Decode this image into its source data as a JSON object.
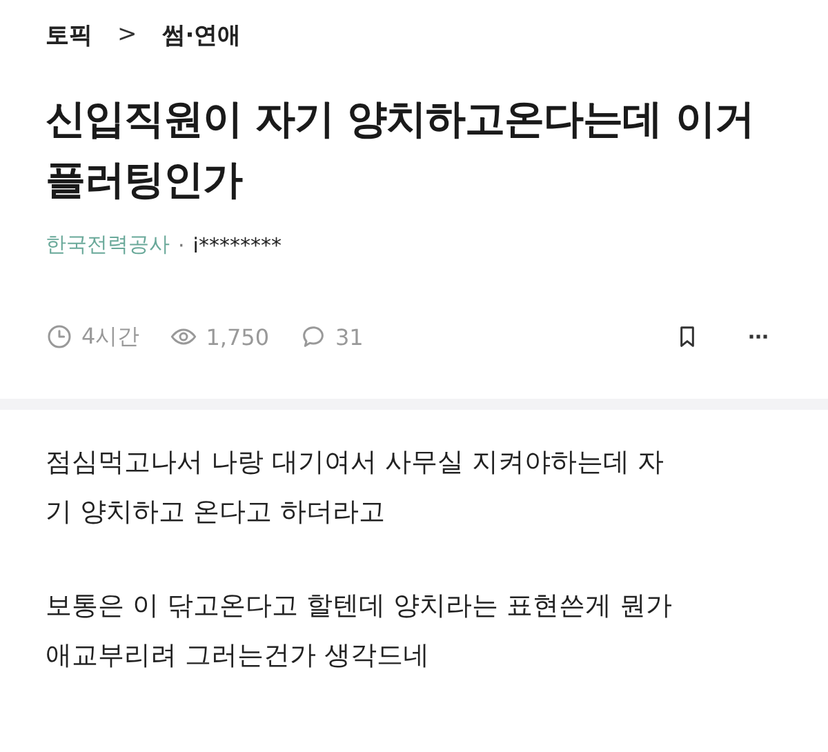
{
  "breadcrumb": {
    "root": "토픽",
    "separator": ">",
    "current": "썸·연애"
  },
  "title_lines": [
    "신입직원이 자기 양치하고온다는데 이거",
    "플러팅인가"
  ],
  "author": {
    "company": "한국전력공사",
    "separator": "·",
    "name": "i********"
  },
  "meta": {
    "time": "4시간",
    "views": "1,750",
    "comments": "31",
    "more": "···"
  },
  "paragraphs": [
    {
      "lines": [
        "점심먹고나서 나랑 대기여서 사무실 지켜야하는데 자",
        "기 양치하고 온다고 하더라고"
      ]
    },
    {
      "lines": [
        "보통은 이 닦고온다고 할텐데 양치라는 표현쓴게 뭔가",
        "애교부리려 그러는건가 생각드네"
      ]
    }
  ]
}
